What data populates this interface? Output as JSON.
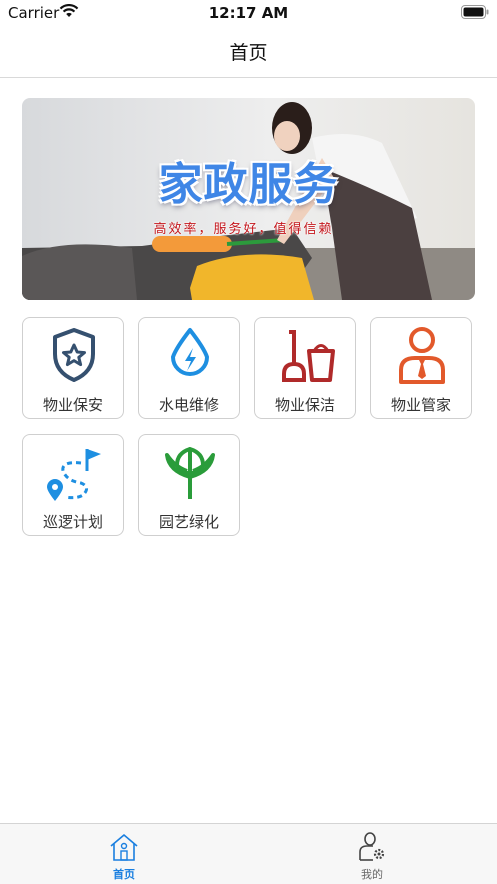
{
  "status_bar": {
    "carrier": "Carrier",
    "time": "12:17 AM"
  },
  "nav": {
    "title": "首页"
  },
  "banner": {
    "title": "家政服务",
    "subtitle": "高效率，服务好，值得信赖"
  },
  "services": [
    {
      "label": "物业保安",
      "icon": "shield-star-icon",
      "color": "#35506f"
    },
    {
      "label": "水电维修",
      "icon": "water-drop-bolt-icon",
      "color": "#1e8fe1"
    },
    {
      "label": "物业保洁",
      "icon": "mop-bucket-icon",
      "color": "#b02a2a"
    },
    {
      "label": "物业管家",
      "icon": "butler-icon",
      "color": "#e2592b"
    },
    {
      "label": "巡逻计划",
      "icon": "patrol-route-icon",
      "color": "#1e8fe1"
    },
    {
      "label": "园艺绿化",
      "icon": "sprout-icon",
      "color": "#2a9c3a"
    }
  ],
  "tab_bar": {
    "items": [
      {
        "label": "首页",
        "icon": "home-icon",
        "active": true
      },
      {
        "label": "我的",
        "icon": "profile-settings-icon",
        "active": false
      }
    ],
    "active_color": "#1a7fe0",
    "inactive_color": "#666666"
  }
}
